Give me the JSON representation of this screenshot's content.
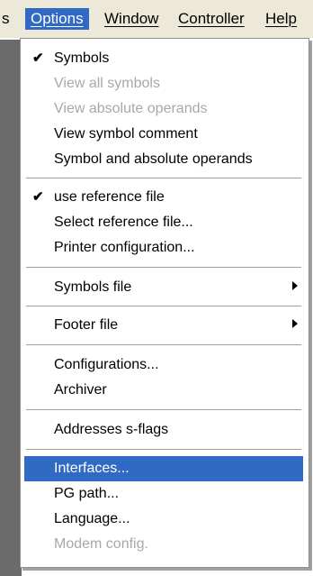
{
  "menubar": {
    "items": [
      {
        "label": "s"
      },
      {
        "label": "Options"
      },
      {
        "label": "Window"
      },
      {
        "label": "Controller"
      },
      {
        "label": "Help"
      }
    ]
  },
  "menu": {
    "groups": [
      [
        {
          "label": "Symbols",
          "checked": true,
          "enabled": true
        },
        {
          "label": "View all symbols",
          "enabled": false
        },
        {
          "label": "View absolute operands",
          "enabled": false
        },
        {
          "label": "View symbol comment",
          "enabled": true
        },
        {
          "label": "Symbol and absolute operands",
          "enabled": true
        }
      ],
      [
        {
          "label": "use reference file",
          "checked": true,
          "enabled": true
        },
        {
          "label": "Select reference file...",
          "enabled": true
        },
        {
          "label": "Printer configuration...",
          "enabled": true
        }
      ],
      [
        {
          "label": "Symbols file",
          "submenu": true,
          "enabled": true
        }
      ],
      [
        {
          "label": "Footer file",
          "submenu": true,
          "enabled": true
        }
      ],
      [
        {
          "label": "Configurations...",
          "enabled": true
        },
        {
          "label": "Archiver",
          "enabled": true
        }
      ],
      [
        {
          "label": "Addresses s-flags",
          "enabled": true
        }
      ],
      [
        {
          "label": "Interfaces...",
          "enabled": true,
          "highlighted": true
        },
        {
          "label": "PG path...",
          "enabled": true
        },
        {
          "label": "Language...",
          "enabled": true
        },
        {
          "label": "Modem config.",
          "enabled": false
        }
      ]
    ]
  },
  "icons": {
    "check": "checkmark-icon",
    "submenu": "submenu-arrow-icon"
  },
  "colors": {
    "highlight": "#316ac5",
    "menubar": "#ece9d8",
    "disabled_text": "#a8a8a8"
  }
}
